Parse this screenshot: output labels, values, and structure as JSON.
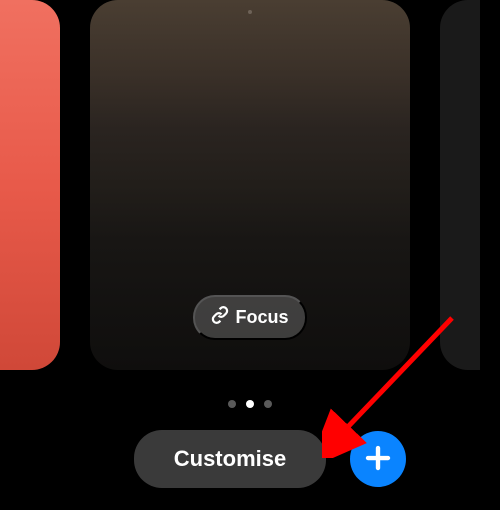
{
  "cards": {
    "center": {
      "focus_label": "Focus"
    }
  },
  "pagination": {
    "count": 3,
    "active_index": 1
  },
  "actions": {
    "customise_label": "Customise",
    "add_icon": "plus-icon",
    "focus_icon": "link-icon"
  },
  "annotation": {
    "arrow_color": "#ff0000"
  }
}
